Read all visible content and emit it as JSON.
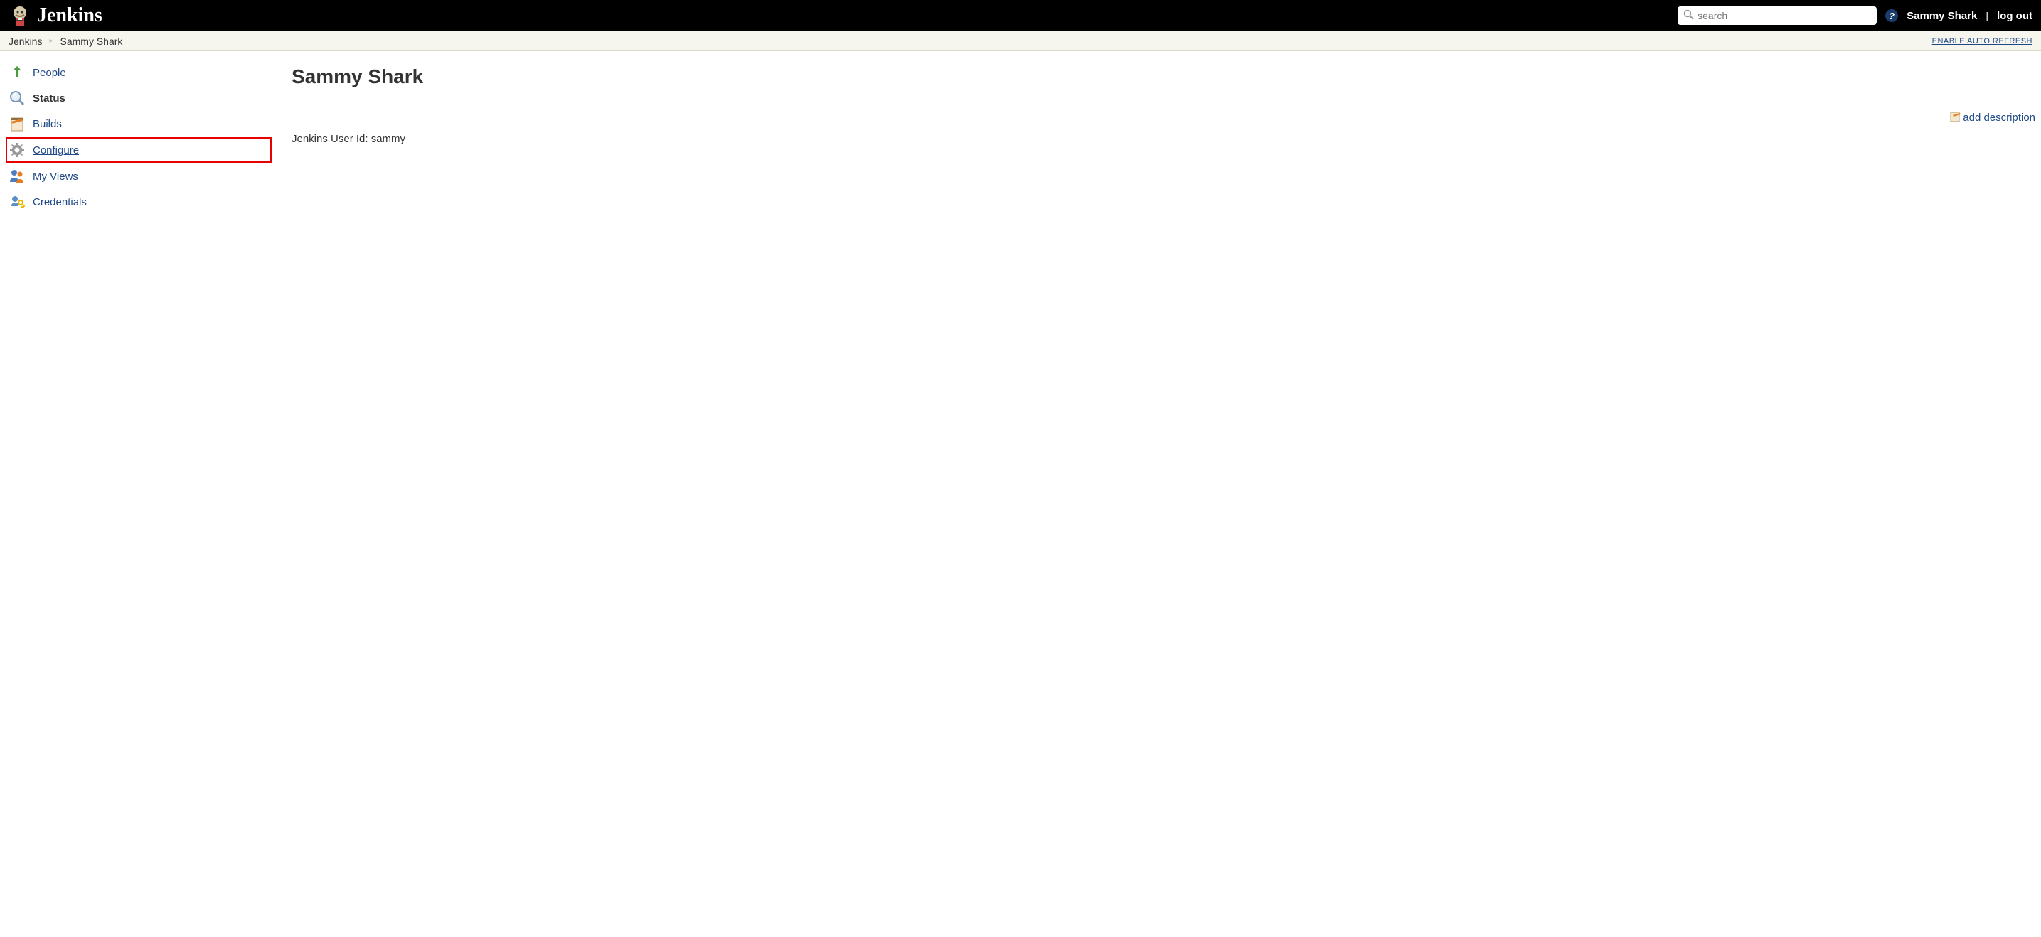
{
  "header": {
    "logo_text": "Jenkins",
    "search_placeholder": "search",
    "username": "Sammy Shark",
    "logout_label": "log out"
  },
  "breadcrumb": {
    "items": [
      "Jenkins",
      "Sammy Shark"
    ],
    "auto_refresh_label": "ENABLE AUTO REFRESH"
  },
  "sidebar": {
    "items": [
      {
        "label": "People",
        "icon": "user-arrow-icon"
      },
      {
        "label": "Status",
        "icon": "magnifier-icon",
        "bold": true
      },
      {
        "label": "Builds",
        "icon": "clipboard-icon"
      },
      {
        "label": "Configure",
        "icon": "gear-icon",
        "highlighted": true,
        "underline": true
      },
      {
        "label": "My Views",
        "icon": "users-icon"
      },
      {
        "label": "Credentials",
        "icon": "key-icon"
      }
    ]
  },
  "main": {
    "title": "Sammy Shark",
    "add_description_label": "add description",
    "user_id_text": "Jenkins User Id: sammy"
  }
}
